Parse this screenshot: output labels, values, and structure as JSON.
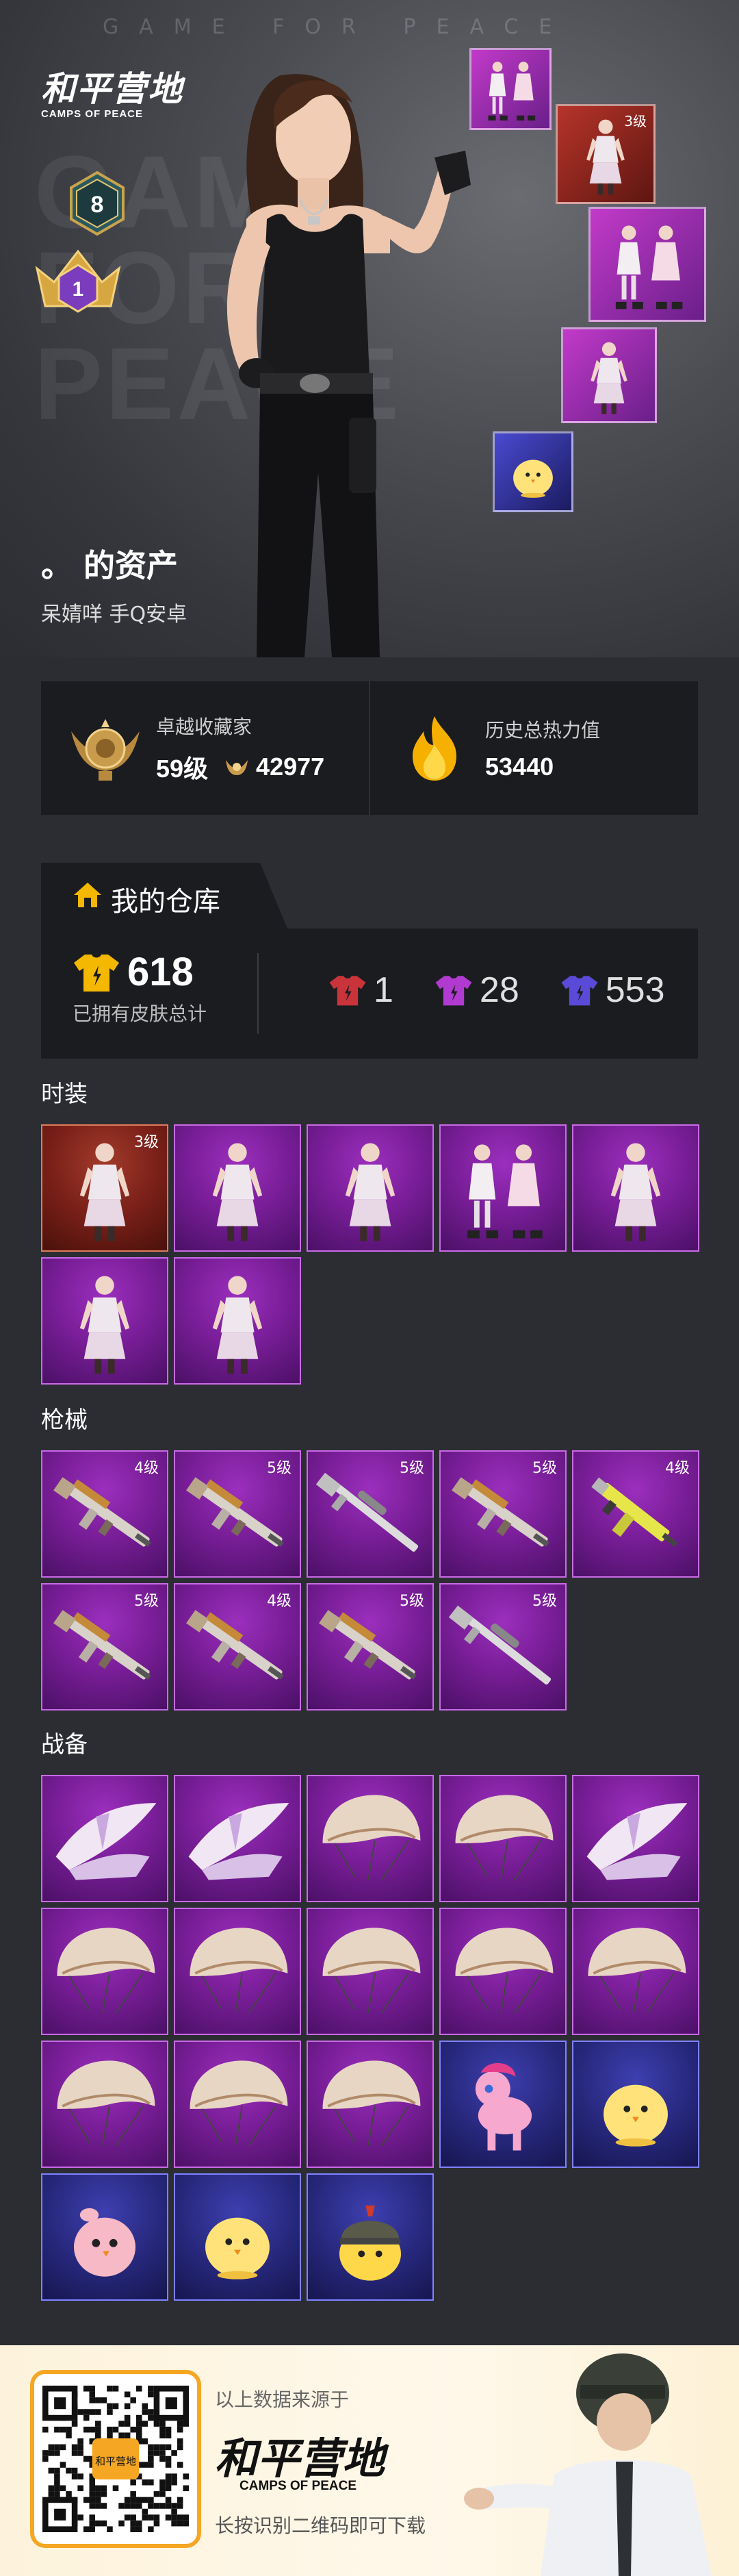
{
  "hero": {
    "watermark": "GAME FOR PEACE",
    "big_text": [
      "GAME",
      "FOR",
      "PEACE"
    ],
    "logo_title": "和平营地",
    "logo_subtitle": "CAMPS OF PEACE",
    "rank_badge_number": "8",
    "crown_badge_number": "1",
    "showcase": [
      {
        "rarity": "purple",
        "level": ""
      },
      {
        "rarity": "red",
        "level": "3级"
      },
      {
        "rarity": "purple",
        "level": ""
      },
      {
        "rarity": "purple",
        "level": ""
      },
      {
        "rarity": "blue",
        "level": ""
      }
    ],
    "owner_title": "。 的资产",
    "owner_sub": "呆婧咩 手Q安卓"
  },
  "stats": {
    "collector_title": "卓越收藏家",
    "collector_level": "59级",
    "collector_points": "42977",
    "heat_title": "历史总热力值",
    "heat_value": "53440"
  },
  "warehouse": {
    "tab_label": "我的仓库",
    "total": "618",
    "total_label": "已拥有皮肤总计",
    "red_count": "1",
    "purple_count": "28",
    "blue_count": "553",
    "colors": {
      "gold": "#f5b800",
      "red": "#c9333a",
      "purple": "#b13ad0",
      "blue": "#5a4ad8"
    }
  },
  "sections": {
    "fashion_label": "时装",
    "guns_label": "枪械",
    "gear_label": "战备"
  },
  "fashion_items": [
    {
      "rarity": "red",
      "level": "3级",
      "icon": "outfit-icon"
    },
    {
      "rarity": "purple",
      "level": "",
      "icon": "outfit-icon"
    },
    {
      "rarity": "purple",
      "level": "",
      "icon": "outfit-icon"
    },
    {
      "rarity": "purple",
      "level": "",
      "icon": "outfit-set-icon"
    },
    {
      "rarity": "purple",
      "level": "",
      "icon": "outfit-icon"
    },
    {
      "rarity": "purple",
      "level": "",
      "icon": "outfit-icon"
    },
    {
      "rarity": "purple",
      "level": "",
      "icon": "outfit-icon"
    }
  ],
  "gun_items": [
    {
      "rarity": "purple",
      "level": "4级",
      "icon": "rifle-icon"
    },
    {
      "rarity": "purple",
      "level": "5级",
      "icon": "rifle-icon"
    },
    {
      "rarity": "purple",
      "level": "5级",
      "icon": "sniper-icon"
    },
    {
      "rarity": "purple",
      "level": "5级",
      "icon": "rifle-icon"
    },
    {
      "rarity": "purple",
      "level": "4级",
      "icon": "smg-icon"
    },
    {
      "rarity": "purple",
      "level": "5级",
      "icon": "rifle-icon"
    },
    {
      "rarity": "purple",
      "level": "4级",
      "icon": "rifle-icon"
    },
    {
      "rarity": "purple",
      "level": "5级",
      "icon": "rifle-icon"
    },
    {
      "rarity": "purple",
      "level": "5级",
      "icon": "sniper-icon"
    }
  ],
  "gear_items": [
    {
      "rarity": "purple",
      "icon": "glider-icon"
    },
    {
      "rarity": "purple",
      "icon": "glider-icon"
    },
    {
      "rarity": "purple",
      "icon": "parachute-icon"
    },
    {
      "rarity": "purple",
      "icon": "parachute-icon"
    },
    {
      "rarity": "purple",
      "icon": "glider-icon"
    },
    {
      "rarity": "purple",
      "icon": "parachute-icon"
    },
    {
      "rarity": "purple",
      "icon": "parachute-icon"
    },
    {
      "rarity": "purple",
      "icon": "parachute-icon"
    },
    {
      "rarity": "purple",
      "icon": "parachute-icon"
    },
    {
      "rarity": "purple",
      "icon": "parachute-icon"
    },
    {
      "rarity": "purple",
      "icon": "parachute-icon"
    },
    {
      "rarity": "purple",
      "icon": "parachute-icon"
    },
    {
      "rarity": "purple",
      "icon": "parachute-icon"
    },
    {
      "rarity": "blue",
      "icon": "pony-icon"
    },
    {
      "rarity": "blue",
      "icon": "chick-icon"
    },
    {
      "rarity": "blue",
      "icon": "bird-icon"
    },
    {
      "rarity": "blue",
      "icon": "chick-icon"
    },
    {
      "rarity": "blue",
      "icon": "chick-helmet-icon"
    }
  ],
  "footer": {
    "source": "以上数据来源于",
    "logo_title": "和平营地",
    "logo_subtitle": "CAMPS OF PEACE",
    "hint": "长按识别二维码即可下载",
    "qr_label": "和平营地"
  }
}
